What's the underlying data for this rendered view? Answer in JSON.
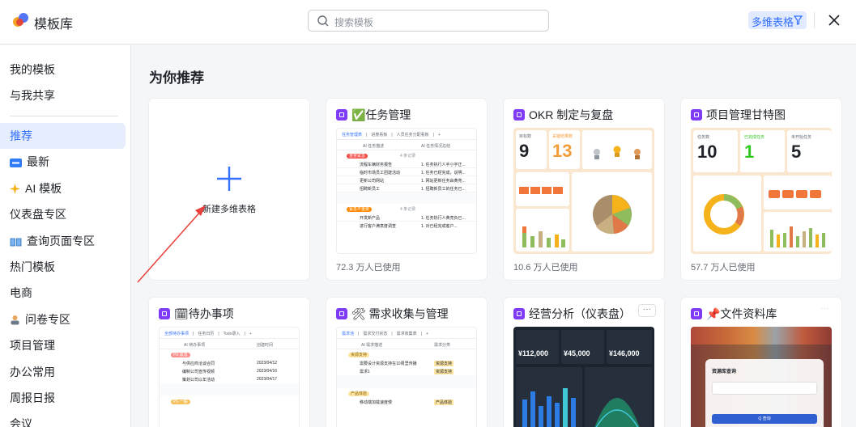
{
  "header": {
    "title": "模板库",
    "search_placeholder": "搜索模板",
    "filter_label": "多维表格"
  },
  "sidebar": {
    "items": [
      {
        "label": "我的模板"
      },
      {
        "label": "与我共享"
      },
      {
        "label": "推荐",
        "active": true
      },
      {
        "label": "最新",
        "icon": "new-badge-icon"
      },
      {
        "label": "AI 模板",
        "icon": "sparkle-icon"
      },
      {
        "label": "仪表盘专区"
      },
      {
        "label": "查询页面专区",
        "icon": "book-icon"
      },
      {
        "label": "热门模板"
      },
      {
        "label": "电商"
      },
      {
        "label": "问卷专区",
        "icon": "person-icon"
      },
      {
        "label": "项目管理"
      },
      {
        "label": "办公常用"
      },
      {
        "label": "周报日报"
      },
      {
        "label": "会议"
      }
    ]
  },
  "main": {
    "section_title": "为你推荐",
    "new_card_label": "新建多维表格",
    "cards": [
      {
        "title": "✅任务管理",
        "usage": "72.3 万人已使用",
        "thumb": {
          "tabs": [
            "任务管理表",
            "进度看板",
            "人员任务分配看板",
            "+"
          ],
          "cols": [
            "AI 任务描述",
            "AI 任务情况总结"
          ],
          "groups": [
            {
              "tag": "重要紧急",
              "count": "4 条记录",
              "rows": [
                [
                  "流程车辆财务报告",
                  "1. 任务执行人手小宇正..."
                ],
                [
                  "临时市场员工团建活动",
                  "1. 任务已经完成，说明..."
                ],
                [
                  "更新公司网站",
                  "1. 网站更新任务由黄亮..."
                ],
                [
                  "招聘新员工",
                  "1. 招聘新员工的任务已..."
                ]
              ]
            },
            {
              "tag": "紧急不重要",
              "count": "4 条记录",
              "rows": [
                [
                  "开发新产品",
                  "1. 任务执行人黄亮负已..."
                ],
                [
                  "进行客户满意度调查",
                  "1. 对已经完成客户..."
                ]
              ]
            }
          ]
        }
      },
      {
        "title": "OKR 制定与复盘",
        "usage": "10.6 万人已使用",
        "thumb": {
          "kpis": [
            {
              "label": "目标数",
              "value": "9"
            },
            {
              "label": "关键结果数",
              "value": "13"
            }
          ],
          "color": "#f29d38"
        }
      },
      {
        "title": "项目管理甘特图",
        "usage": "57.7 万人已使用",
        "thumb": {
          "kpis": [
            {
              "label": "任务数",
              "value": "10"
            },
            {
              "label": "已完成任务",
              "value": "1"
            },
            {
              "label": "未开始任务",
              "value": "5"
            }
          ]
        }
      },
      {
        "title": "🗓待办事项",
        "thumb": {
          "tabs": [
            "全部待办事项",
            "任务日历",
            "Todo录入",
            "+"
          ],
          "cols": [
            "AI 待办事项",
            "创建时间"
          ],
          "group_tag": "P0-紧急",
          "rows": [
            [
              "与供应商洽谈合同",
              "2023/04/12"
            ],
            [
              "编制公司宣传视频",
              "2023/04/16"
            ],
            [
              "策划公司以年活动",
              "2023/04/17"
            ]
          ],
          "group2": "P1-一般"
        }
      },
      {
        "title": "🛠 需求收集与管理",
        "thumb": {
          "tabs": [
            "需求池",
            "需求交付状态",
            "需求收集表",
            "+"
          ],
          "cols": [
            "AI 需求描述",
            "需求分类"
          ],
          "group_tag": "资源支持",
          "rows": [
            [
              "需要设计资源支持在10周里传播",
              "资源支持"
            ],
            [
              "需求1",
              "资源支持"
            ]
          ],
          "group2": "产品体验",
          "row3": [
            "移动端加载速度慢",
            "产品体验"
          ]
        }
      },
      {
        "title": "经营分析（仪表盘）",
        "more": "···",
        "thumb": {
          "kpis": [
            "¥112,000",
            "¥45,000",
            "¥146,000"
          ]
        }
      },
      {
        "title": "📌文件资料库",
        "more": "···",
        "thumb": {
          "dialog_title": "资源库查询",
          "button": "Q 查询"
        }
      }
    ]
  },
  "colors": {
    "accent": "#3370ff",
    "badge": "#7f3bf5",
    "arrow": "#e8403a"
  }
}
